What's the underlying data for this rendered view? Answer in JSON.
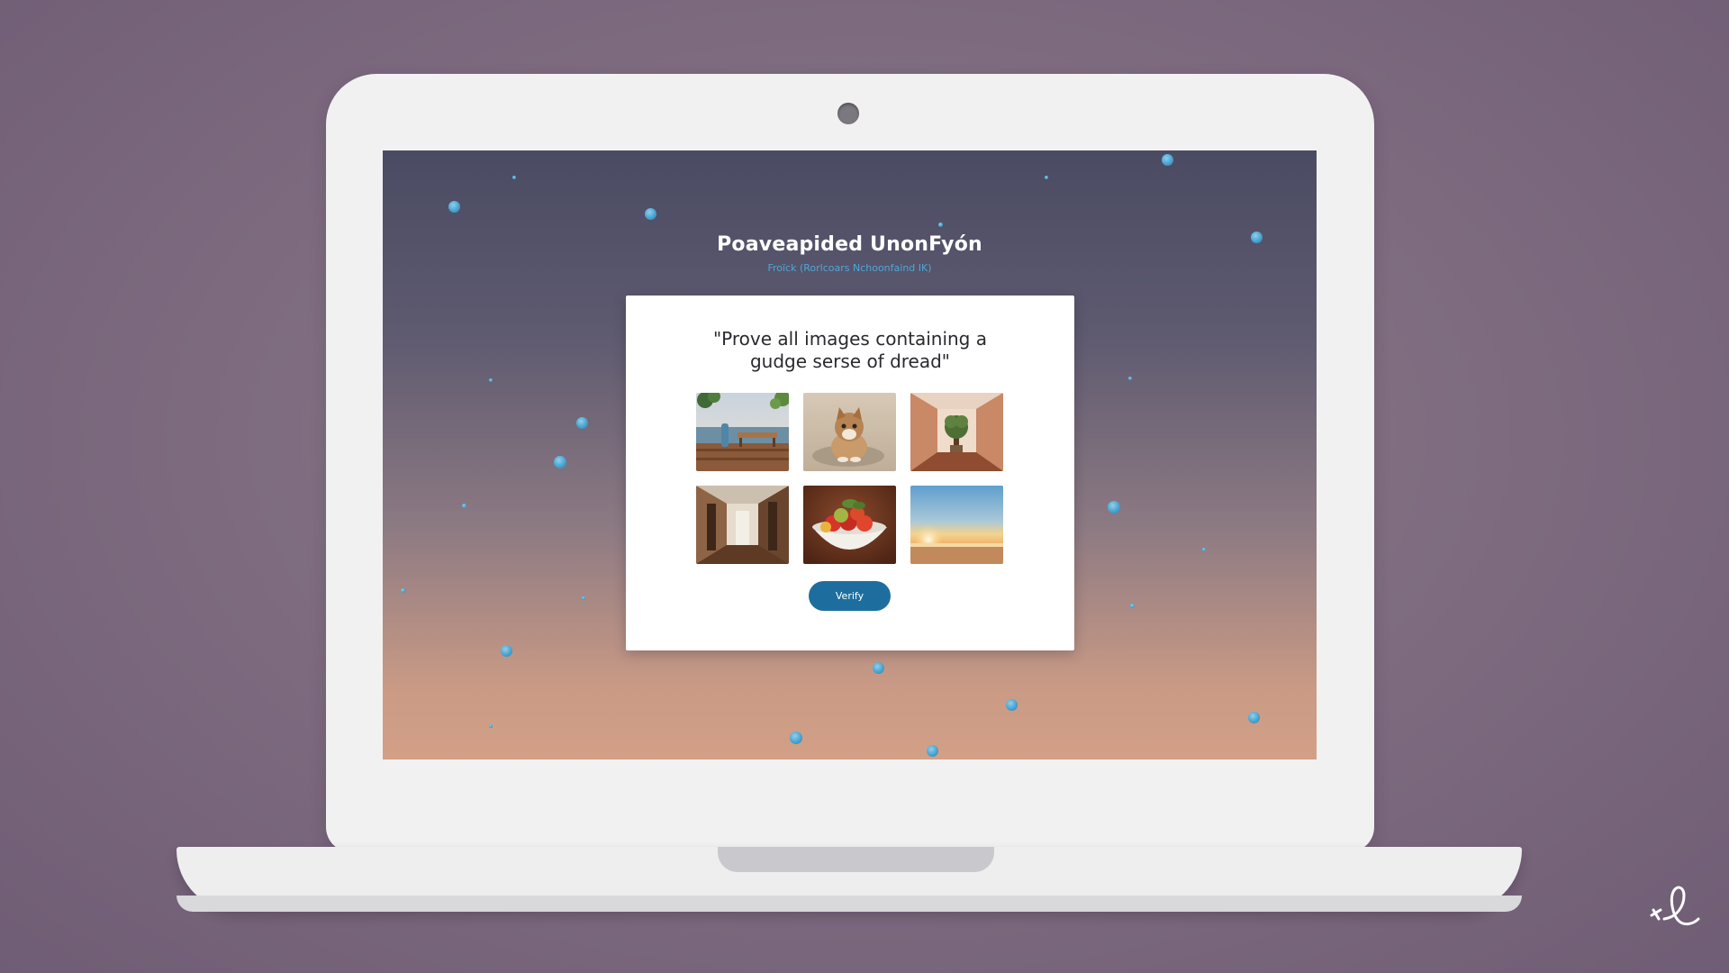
{
  "page": {
    "title": "Poaveapided UnonFyón",
    "subtitle": "Froïck (Rorlcoars Nchoonfaind IK)"
  },
  "captcha": {
    "prompt_line1": "\"Prove all images containing a",
    "prompt_line2": "gudge serse of dread\"",
    "verify_label": "Verify",
    "tiles": [
      {
        "subject": "bench by the sea with vase"
      },
      {
        "subject": "kitten on carpet"
      },
      {
        "subject": "hallway with potted tree"
      },
      {
        "subject": "empty corridor with doorways"
      },
      {
        "subject": "bowl of fruit"
      },
      {
        "subject": "sunset over beach"
      }
    ]
  },
  "colors": {
    "accent": "#1d6e9e",
    "particle": "#4aa3cf",
    "subtitle": "#4fa7d6"
  },
  "icons": {
    "webcam": "webcam-icon",
    "signature": "signature-mark"
  }
}
